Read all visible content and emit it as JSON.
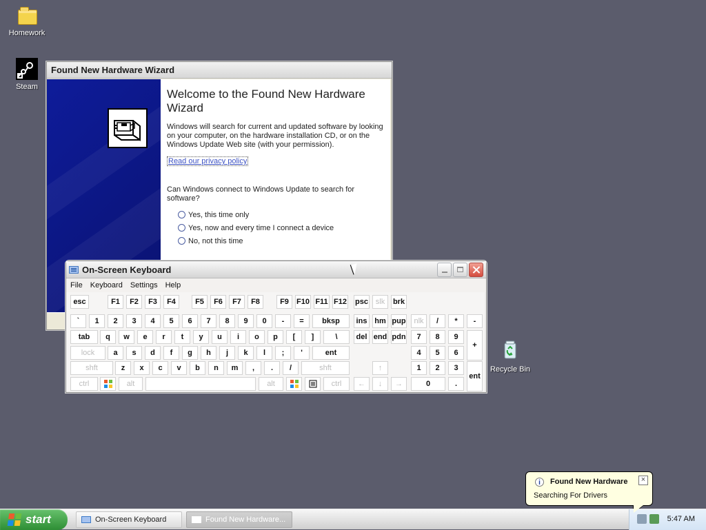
{
  "desktop": {
    "icons": {
      "homework": {
        "label": "Homework"
      },
      "steam": {
        "label": "Steam"
      },
      "recycle_bin": {
        "label": "Recycle Bin"
      }
    }
  },
  "wizard": {
    "title": "Found New Hardware Wizard",
    "heading": "Welcome to the Found New Hardware Wizard",
    "intro": "Windows will search for current and updated software by looking on your computer, on the hardware installation CD, or on the Windows Update Web site (with your permission).",
    "privacy_link": "Read our privacy policy",
    "question": "Can Windows connect to Windows Update to search for software?",
    "options": [
      "Yes, this time only",
      "Yes, now and every time I connect a device",
      "No, not this time"
    ]
  },
  "osk": {
    "title": "On-Screen Keyboard",
    "menu": [
      "File",
      "Keyboard",
      "Settings",
      "Help"
    ],
    "rows": {
      "fn": [
        "esc",
        "F1",
        "F2",
        "F3",
        "F4",
        "F5",
        "F6",
        "F7",
        "F8",
        "F9",
        "F10",
        "F11",
        "F12",
        "psc",
        "slk",
        "brk"
      ],
      "number": [
        "`",
        "1",
        "2",
        "3",
        "4",
        "5",
        "6",
        "7",
        "8",
        "9",
        "0",
        "-",
        "=",
        "bksp",
        "ins",
        "hm",
        "pup",
        "nlk",
        "/",
        "*",
        "-"
      ],
      "tab": [
        "tab",
        "q",
        "w",
        "e",
        "r",
        "t",
        "y",
        "u",
        "i",
        "o",
        "p",
        "[",
        "]",
        "\\",
        "del",
        "end",
        "pdn",
        "7",
        "8",
        "9",
        "+"
      ],
      "home": [
        "lock",
        "a",
        "s",
        "d",
        "f",
        "g",
        "h",
        "j",
        "k",
        "l",
        ";",
        "'",
        "ent",
        "4",
        "5",
        "6"
      ],
      "shift": [
        "shft",
        "z",
        "x",
        "c",
        "v",
        "b",
        "n",
        "m",
        ",",
        ".",
        "/",
        "shft",
        "↑",
        "1",
        "2",
        "3",
        "ent"
      ],
      "bottom": [
        "ctrl",
        "alt",
        "alt",
        "ctrl",
        "←",
        "↓",
        "→",
        "0",
        "."
      ]
    }
  },
  "taskbar": {
    "start": "start",
    "buttons": [
      "On-Screen Keyboard",
      "Found New Hardware..."
    ],
    "time": "5:47 AM"
  },
  "balloon": {
    "title": "Found New Hardware",
    "text": "Searching For Drivers",
    "close": "×",
    "info": "i"
  },
  "colors": {
    "desktop": "#5B5C6C",
    "wizard_blue": "#0E1C9A",
    "link_blue": "#3F54C4",
    "start_green": "#2E8E35"
  }
}
